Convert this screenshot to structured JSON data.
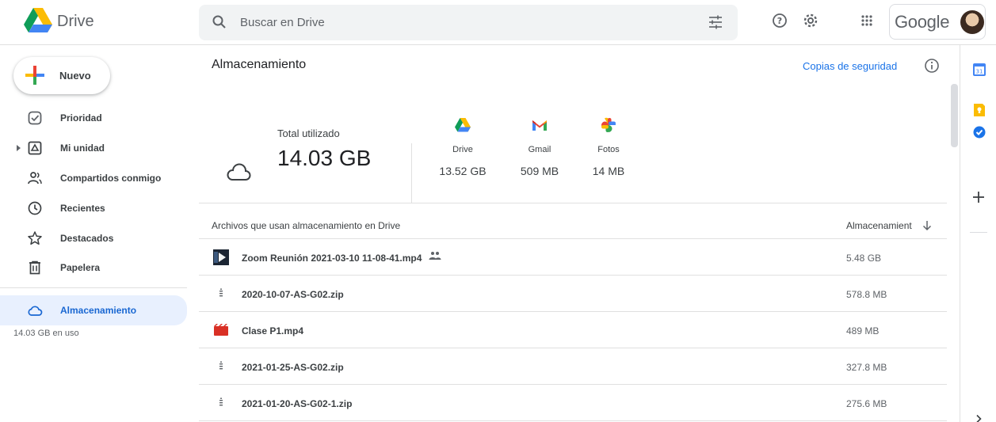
{
  "header": {
    "app_name": "Drive",
    "search_placeholder": "Buscar en Drive",
    "account_brand": "Google",
    "icons": [
      "drive-logo",
      "search-icon",
      "tune-icon",
      "help-icon",
      "settings-icon",
      "apps-grid-icon",
      "avatar"
    ]
  },
  "sidebar": {
    "new_label": "Nuevo",
    "items": [
      {
        "label": "Prioridad",
        "icon": "priority-icon"
      },
      {
        "label": "Mi unidad",
        "icon": "my-drive-icon"
      },
      {
        "label": "Compartidos conmigo",
        "icon": "shared-icon"
      },
      {
        "label": "Recientes",
        "icon": "clock-icon"
      },
      {
        "label": "Destacados",
        "icon": "star-icon"
      },
      {
        "label": "Papelera",
        "icon": "trash-icon"
      },
      {
        "label": "Almacenamiento",
        "icon": "cloud-icon",
        "active": true
      }
    ],
    "usage_text": "14.03 GB en uso"
  },
  "main": {
    "title": "Almacenamiento",
    "backup_link": "Copias de seguridad",
    "summary": {
      "total_label": "Total utilizado",
      "total_value": "14.03 GB",
      "services": [
        {
          "name": "Drive",
          "value": "13.52 GB",
          "icon": "drive-icon"
        },
        {
          "name": "Gmail",
          "value": "509 MB",
          "icon": "gmail-icon"
        },
        {
          "name": "Fotos",
          "value": "14 MB",
          "icon": "photos-icon"
        }
      ]
    },
    "table": {
      "col_files": "Archivos que usan almacenamiento en Drive",
      "col_storage": "Almacenamient",
      "sort": "descending",
      "rows": [
        {
          "name": "Zoom Reunión 2021-03-10 11-08-41.mp4",
          "size": "5.48 GB",
          "type": "video-thumbnail",
          "shared": true
        },
        {
          "name": "2020-10-07-AS-G02.zip",
          "size": "578.8 MB",
          "type": "zip",
          "shared": false
        },
        {
          "name": "Clase P1.mp4",
          "size": "489 MB",
          "type": "video",
          "shared": false
        },
        {
          "name": "2021-01-25-AS-G02.zip",
          "size": "327.8 MB",
          "type": "zip",
          "shared": false
        },
        {
          "name": "2021-01-20-AS-G02-1.zip",
          "size": "275.6 MB",
          "type": "zip",
          "shared": false
        }
      ]
    }
  },
  "side_panel": {
    "calendar_day": "31",
    "icons": [
      "calendar-icon",
      "keep-icon",
      "tasks-icon",
      "add-icon",
      "chevron-right-icon"
    ]
  },
  "colors": {
    "accent": "#1a73e8",
    "active_bg": "#e8f0fe",
    "active_text": "#1967d2",
    "zip_icon": "#5f6368",
    "video_icon": "#d93025"
  }
}
